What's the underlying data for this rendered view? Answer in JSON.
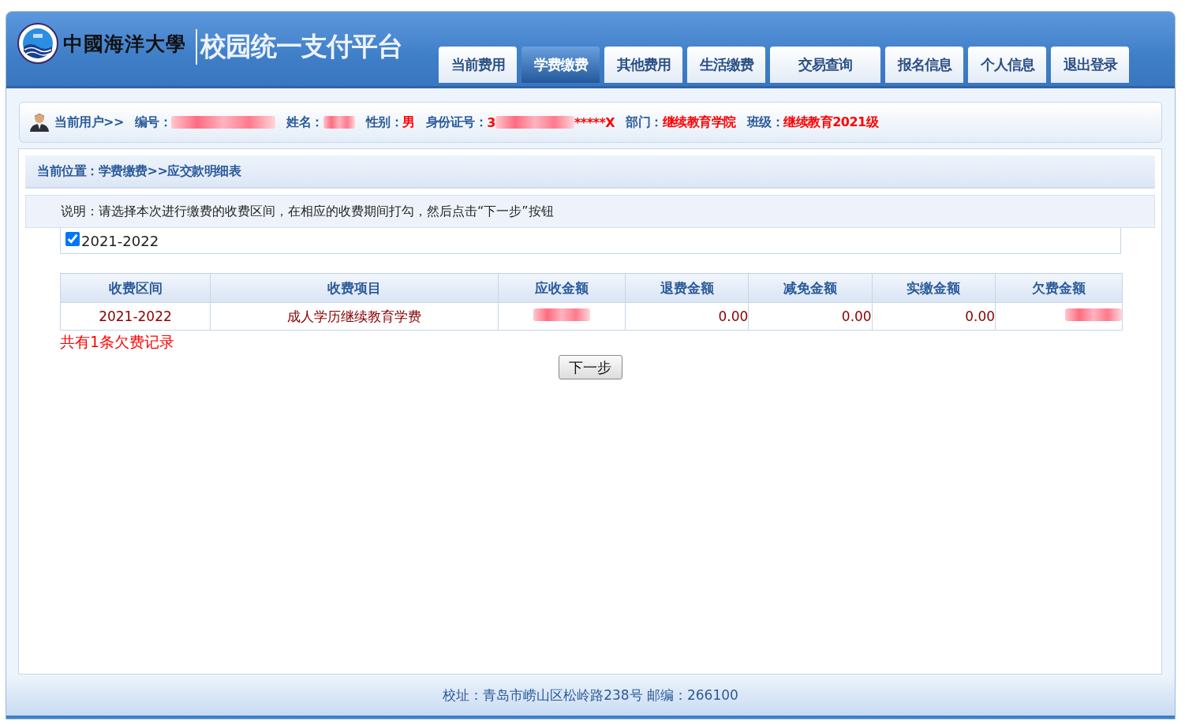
{
  "header": {
    "logo_text": "中國海洋大學",
    "title": "校园统一支付平台"
  },
  "tabs": [
    {
      "label": "当前费用",
      "selected": false
    },
    {
      "label": "学费缴费",
      "selected": true
    },
    {
      "label": "其他费用",
      "selected": false
    },
    {
      "label": "生活缴费",
      "selected": false
    },
    {
      "label": "交易查询",
      "selected": false
    },
    {
      "label": "报名信息",
      "selected": false
    },
    {
      "label": "个人信息",
      "selected": false
    },
    {
      "label": "退出登录",
      "selected": false
    }
  ],
  "user_bar": {
    "prefix": "当前用户>>",
    "fields": [
      {
        "label": "编号：",
        "redacted": true
      },
      {
        "label": "姓名：",
        "redacted": true
      },
      {
        "label": "性别：",
        "value": "男",
        "redacted": false
      },
      {
        "label": "身份证号：",
        "value": "3",
        "redacted": true,
        "suffix": "*****X"
      },
      {
        "label": "部门：",
        "value": "继续教育学院",
        "redacted": false
      },
      {
        "label": "班级：",
        "value": "继续教育2021级",
        "redacted": false
      }
    ]
  },
  "breadcrumb": "当前位置：学费缴费>>应交款明细表",
  "instructions": "说明：请选择本次进行缴费的收费区间，在相应的收费期间打勾，然后点击“下一步”按钮",
  "period": {
    "label": "2021-2022",
    "checked": true
  },
  "table": {
    "columns": [
      "收费区间",
      "收费项目",
      "应收金额",
      "退费金额",
      "减免金额",
      "实缴金额",
      "欠费金额"
    ],
    "rows": [
      {
        "cells": [
          {
            "text": "2021-2022",
            "redacted": false
          },
          {
            "text": "成人学历继续教育学费",
            "redacted": false
          },
          {
            "redacted": true
          },
          {
            "text": "0.00",
            "redacted": false
          },
          {
            "text": "0.00",
            "redacted": false
          },
          {
            "text": "0.00",
            "redacted": false
          },
          {
            "redacted": true
          }
        ]
      }
    ]
  },
  "summary": "共有1条欠费记录",
  "next_button": "下一步",
  "footer": "校址：青岛市崂山区松岭路238号 邮编：266100"
}
